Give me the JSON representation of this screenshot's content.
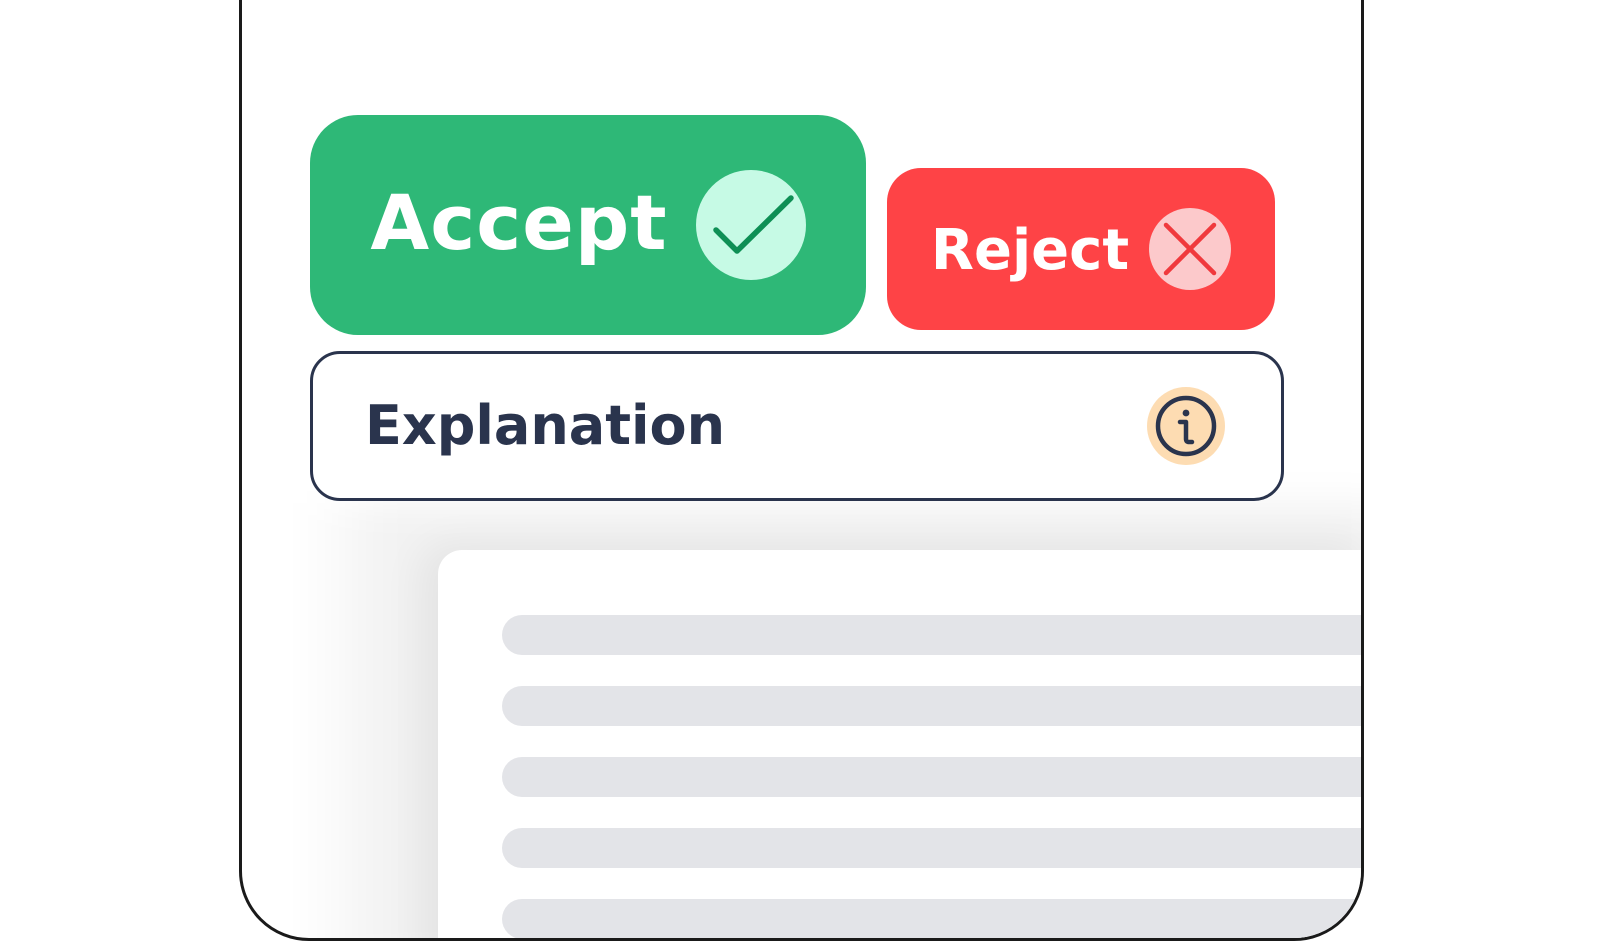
{
  "actions": {
    "accept": {
      "label": "Accept",
      "icon": "checkmark-icon",
      "color": "#2eb877",
      "icon_bg": "#c6fae5",
      "icon_stroke": "#0e8f55"
    },
    "reject": {
      "label": "Reject",
      "icon": "close-icon",
      "color": "#fe4346",
      "icon_bg": "#fcc9cb",
      "icon_stroke": "#f0393d"
    }
  },
  "explanation": {
    "label": "Explanation",
    "icon": "info-icon",
    "border_color": "#2a344d",
    "icon_bg": "#fddcb2"
  },
  "document": {
    "line_color": "#e3e4e8",
    "line_count": 5
  }
}
